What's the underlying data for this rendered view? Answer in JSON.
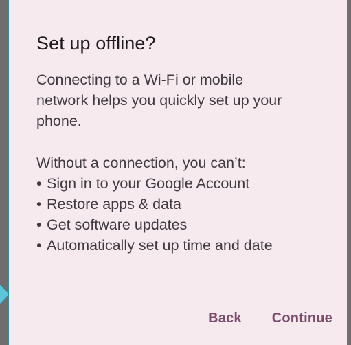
{
  "dialog": {
    "title": "Set up offline?",
    "intro": "Connecting to a Wi-Fi or mobile network helps you quickly set up your phone.",
    "lead": "Without a connection, you can’t:",
    "bullets": [
      "Sign in to your Google Account",
      "Restore apps & data",
      "Get software updates",
      "Automatically set up time and date"
    ],
    "back_label": "Back",
    "continue_label": "Continue"
  },
  "colors": {
    "background": "#f6eaee",
    "text": "#3f3a42",
    "title": "#1d1b20",
    "accent": "#7c4b6e"
  }
}
